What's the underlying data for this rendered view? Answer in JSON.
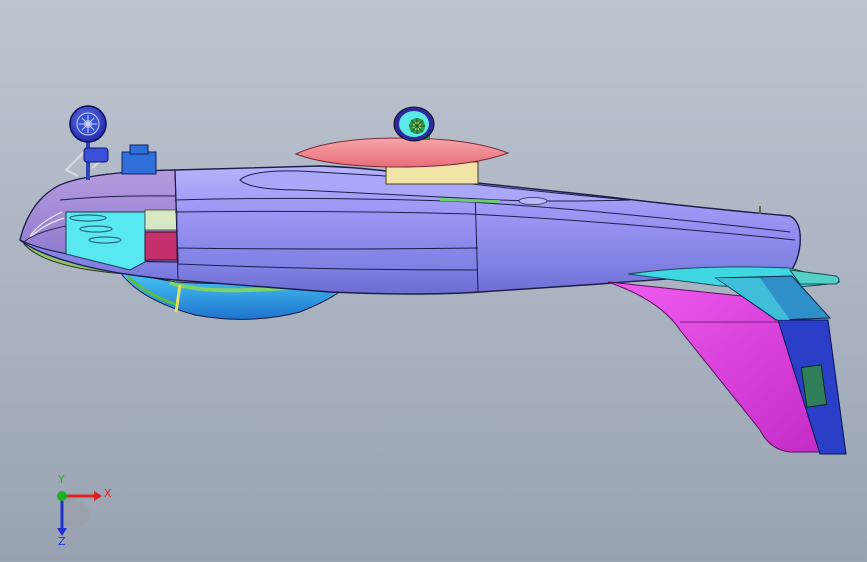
{
  "viewport": {
    "background_top": "#bcc4cf",
    "background_bottom": "#98a3b2"
  },
  "model": {
    "fuselage_color": "#8f8ff2",
    "nose_color": "#a184d8",
    "canopy_color": "#f07e86",
    "canopy_base_color": "#f2e3a6",
    "tail_color": "#e13fe0",
    "rudder_color": "#2a3ec8",
    "stabilizer_color": "#3fd8e2",
    "belly_pod_color": "#2f97df",
    "wheel_color": "#2f38c8",
    "cockpit_panel_color": "#53e6ef",
    "icons": [
      "landing-gear-wheel",
      "engine-fan-wheel"
    ]
  },
  "triad": {
    "x_label": "X",
    "y_label": "Y",
    "z_label": "Z",
    "x_color": "#e02020",
    "y_color": "#20b020",
    "z_color": "#2030d0"
  }
}
